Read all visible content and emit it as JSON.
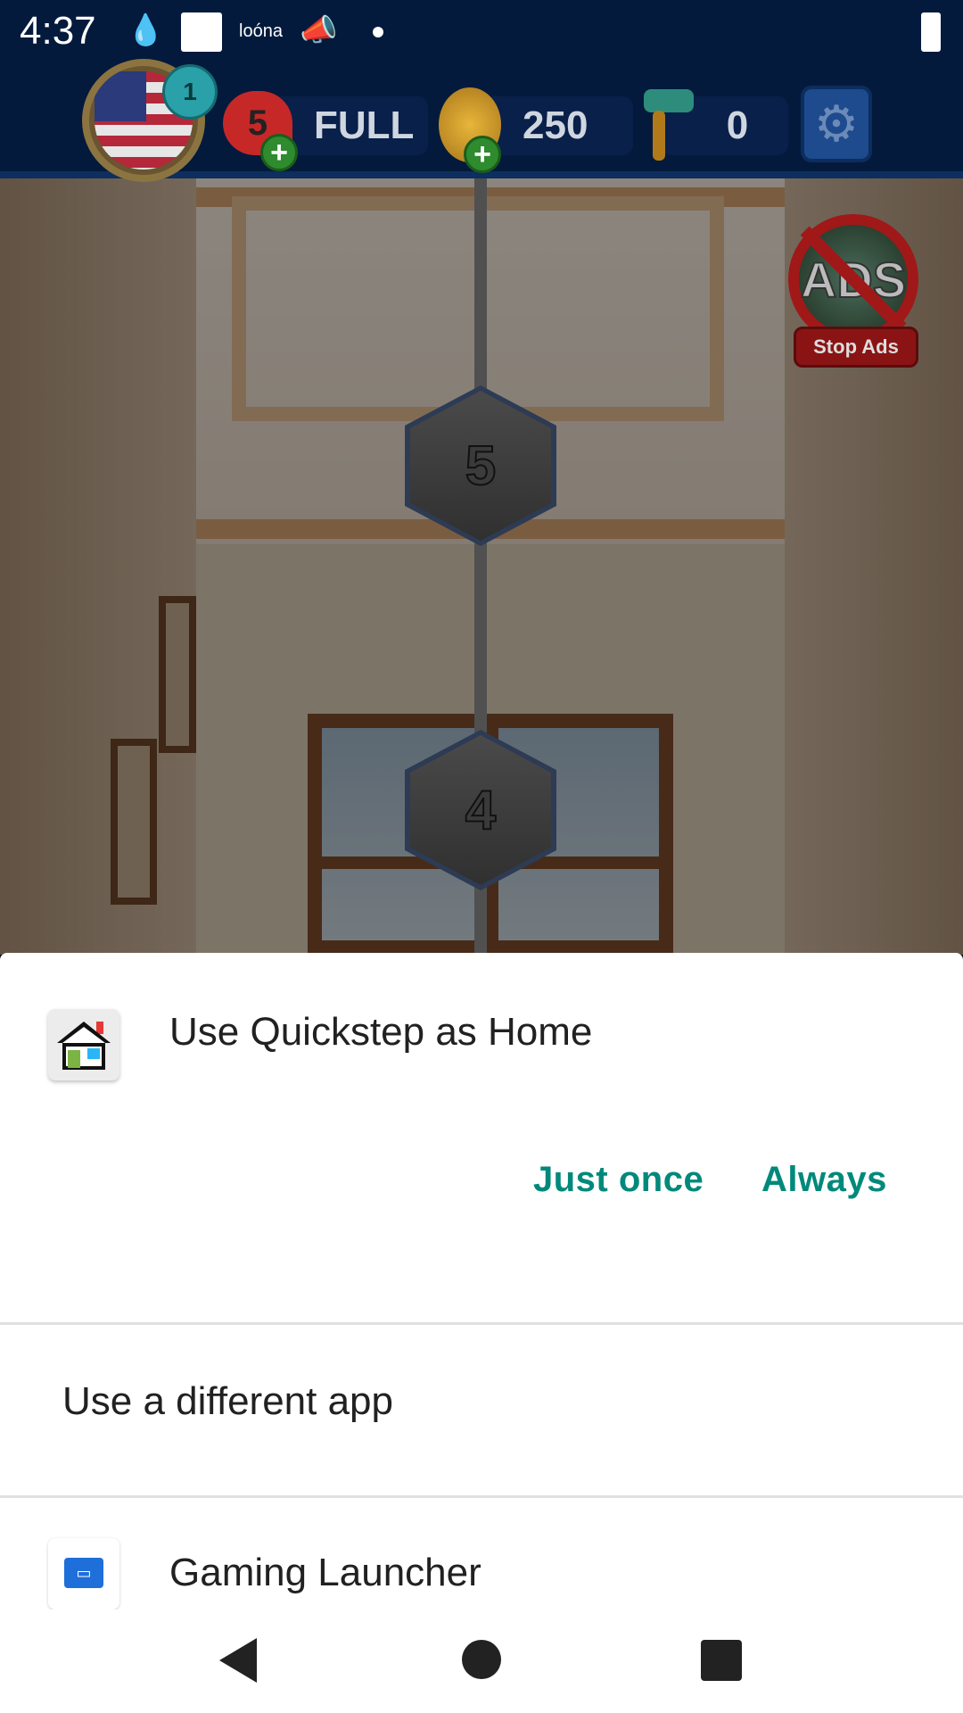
{
  "status_bar": {
    "time": "4:37",
    "notif_text": "loóna",
    "icons": [
      "water-drop-icon",
      "white-square-icon",
      "megaphone-icon",
      "dot-icon",
      "battery-charging-icon"
    ]
  },
  "hud": {
    "level": "1",
    "lives": "5",
    "lives_status": "FULL",
    "coins": "250",
    "paint_rollers": "0",
    "settings_icon": "gear-icon"
  },
  "game": {
    "levels": [
      "5",
      "4"
    ],
    "stop_ads_badge": "ADS",
    "stop_ads_label": "Stop Ads"
  },
  "chooser": {
    "title": "Use Quickstep as Home",
    "app_icon": "house-icon",
    "just_once": "Just once",
    "always": "Always",
    "different_app": "Use a different app",
    "other_app_label": "Gaming Launcher",
    "other_app_icon": "gamepad-icon",
    "accent_color": "#00897b"
  },
  "nav": {
    "back": "back-icon",
    "home": "home-icon",
    "recents": "recents-icon"
  }
}
